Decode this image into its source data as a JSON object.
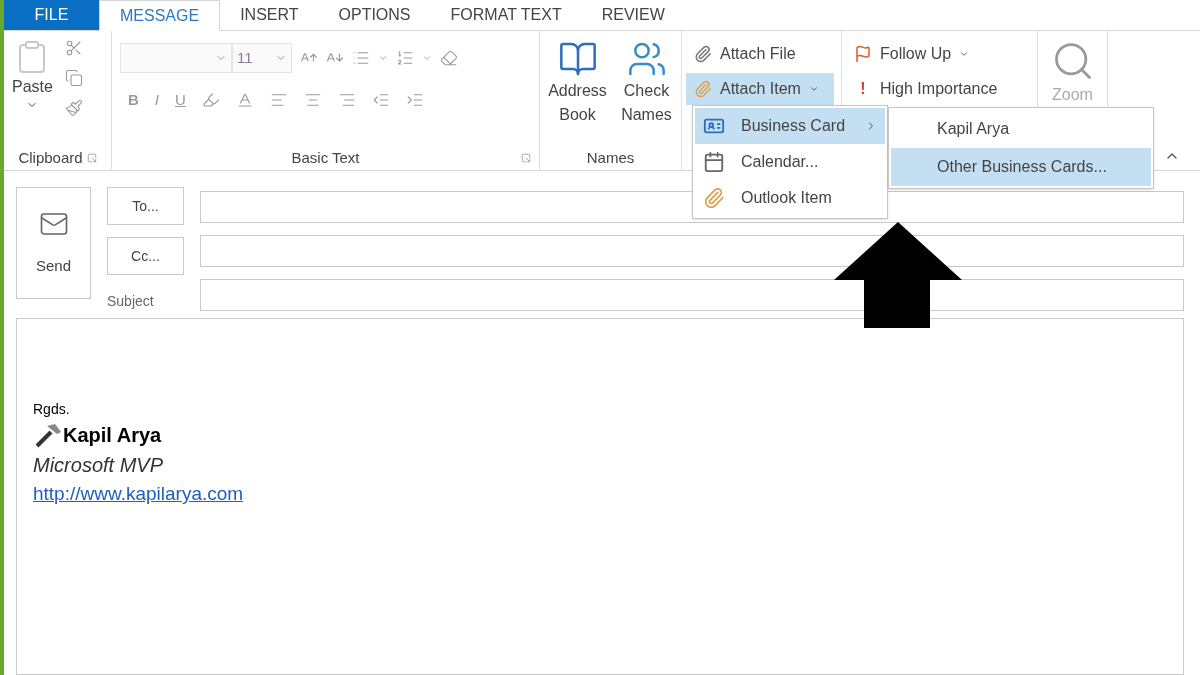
{
  "file_tab": "FILE",
  "tabs": [
    {
      "label": "MESSAGE",
      "kind": "tab",
      "selected": true
    },
    {
      "label": "INSERT",
      "kind": "tab",
      "selected": false
    },
    {
      "label": "OPTIONS",
      "kind": "tab",
      "selected": false
    },
    {
      "label": "FORMAT TEXT",
      "kind": "tab",
      "selected": false
    },
    {
      "label": "REVIEW",
      "kind": "tab",
      "selected": false
    }
  ],
  "ribbon": {
    "clipboard": {
      "paste": "Paste",
      "label": "Clipboard"
    },
    "basic_text": {
      "font_size": "11",
      "format_buttons": [
        "B",
        "I",
        "U"
      ],
      "label": "Basic Text"
    },
    "names": {
      "address_book": "Address Book",
      "check_names": "Check Names",
      "label": "Names"
    },
    "include": {
      "attach_file": "Attach File",
      "attach_item": {
        "label": "Attach Item",
        "selected": true
      }
    },
    "tags": {
      "follow_up": "Follow Up",
      "high_importance": "High Importance",
      "importance_mark": "!"
    },
    "zoom": "Zoom"
  },
  "attach_menu": [
    {
      "label": "Business Card",
      "kind": "card",
      "submenu": true,
      "selected": true
    },
    {
      "label": "Calendar...",
      "kind": "calendar",
      "submenu": false,
      "selected": false
    },
    {
      "label": "Outlook Item",
      "kind": "item",
      "submenu": false,
      "selected": false
    }
  ],
  "business_card_menu": [
    {
      "label": "Kapil Arya",
      "selected": false
    },
    {
      "label": "Other Business Cards...",
      "selected": true
    }
  ],
  "compose": {
    "send": "Send",
    "to": "To...",
    "cc": "Cc...",
    "subject": "Subject"
  },
  "body": {
    "greeting": "Rgds.",
    "name": "Kapil Arya",
    "title": "Microsoft MVP",
    "link": "http://www.kapilarya.com"
  }
}
